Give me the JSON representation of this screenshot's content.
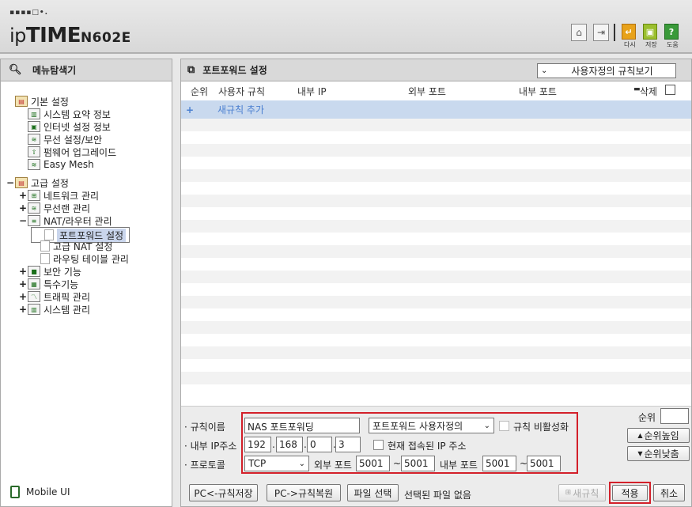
{
  "header": {
    "logo_dots": "▪▪▪▪□•.",
    "logo_prefix": "ip",
    "logo_brand": "TIME",
    "logo_model": "N602E",
    "buttons": [
      {
        "icon": "home-icon",
        "label": ""
      },
      {
        "icon": "logout-icon",
        "label": ""
      },
      {
        "icon": "refresh-icon",
        "label": "다시",
        "color": "#e8a21a"
      },
      {
        "icon": "save-icon",
        "label": "저장",
        "color": "#9bbf2e"
      },
      {
        "icon": "help-icon",
        "label": "도움",
        "color": "#3a9a3a"
      }
    ]
  },
  "left": {
    "title": "메뉴탐색기",
    "tree": [
      {
        "toggle": "",
        "label": "기본 설정",
        "level": 0,
        "icon": "folder"
      },
      {
        "toggle": "",
        "label": "시스템 요약 정보",
        "level": 1,
        "icon": "chart"
      },
      {
        "toggle": "",
        "label": "인터넷 설정 정보",
        "level": 1,
        "icon": "monitor"
      },
      {
        "toggle": "",
        "label": "무선 설정/보안",
        "level": 1,
        "icon": "wifi"
      },
      {
        "toggle": "",
        "label": "펌웨어 업그레이드",
        "level": 1,
        "icon": "upgrade"
      },
      {
        "toggle": "",
        "label": "Easy Mesh",
        "level": 1,
        "icon": "wifi"
      },
      {
        "toggle": "−",
        "label": "고급 설정",
        "level": 0,
        "icon": "folder"
      },
      {
        "toggle": "+",
        "label": "네트워크 관리",
        "level": 1,
        "icon": "network"
      },
      {
        "toggle": "+",
        "label": "무선랜 관리",
        "level": 1,
        "icon": "wifi"
      },
      {
        "toggle": "−",
        "label": "NAT/라우터 관리",
        "level": 1,
        "icon": "router"
      },
      {
        "toggle": "",
        "label": "포트포워드 설정",
        "level": 2,
        "icon": "page",
        "selected": true
      },
      {
        "toggle": "",
        "label": "고급 NAT 설정",
        "level": 2,
        "icon": "page"
      },
      {
        "toggle": "",
        "label": "라우팅 테이블 관리",
        "level": 2,
        "icon": "page"
      },
      {
        "toggle": "+",
        "label": "보안 기능",
        "level": 1,
        "icon": "lock"
      },
      {
        "toggle": "+",
        "label": "특수기능",
        "level": 1,
        "icon": "special"
      },
      {
        "toggle": "+",
        "label": "트래픽 관리",
        "level": 1,
        "icon": "traffic"
      },
      {
        "toggle": "+",
        "label": "시스템 관리",
        "level": 1,
        "icon": "system"
      }
    ],
    "mobile_ui": "Mobile UI"
  },
  "right": {
    "title": "포트포워드 설정",
    "view_select": "사용자정의 규칙보기",
    "columns": {
      "order": "순위",
      "rule": "사용자 규칙",
      "internal_ip": "내부 IP",
      "external_port": "외부 포트",
      "internal_port": "내부 포트",
      "delete": "삭제"
    },
    "new_rule_row": {
      "plus": "+",
      "label": "새규칙 추가"
    }
  },
  "form": {
    "rule_name_label": "규칙이름",
    "rule_name_value": "NAS 포트포워딩",
    "rule_type_value": "포트포워드 사용자정의",
    "disable_label": "규칙 비활성화",
    "internal_ip_label": "내부 IP주소",
    "ip": [
      "192",
      "168",
      "0",
      "3"
    ],
    "current_ip_label": "현재 접속된 IP 주소",
    "protocol_label": "프로토콜",
    "protocol_value": "TCP",
    "external_port_label": "외부 포트",
    "external_port_from": "5001",
    "external_port_to": "5001",
    "internal_port_label": "내부 포트",
    "internal_port_from": "5001",
    "internal_port_to": "5001",
    "tilde": "~",
    "priority_label": "순위",
    "priority_up": "순위높임",
    "priority_down": "순위낮춤"
  },
  "buttons": {
    "save_rules": "PC<-규칙저장",
    "restore_rules": "PC->규칙복원",
    "file_select": "파일 선택",
    "no_file": "선택된 파일 없음",
    "new_rule": "새규칙",
    "apply": "적용",
    "cancel": "취소"
  }
}
